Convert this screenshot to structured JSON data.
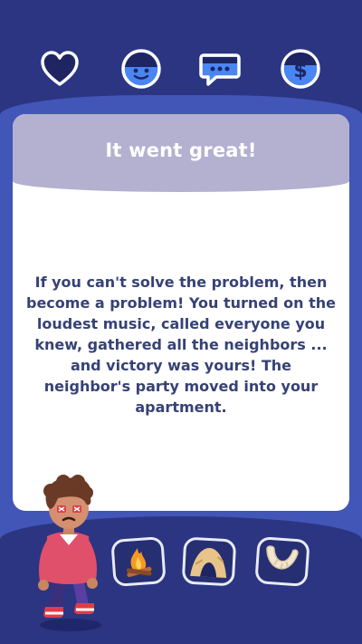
{
  "stats": {
    "items": [
      {
        "icon": "heart-icon"
      },
      {
        "icon": "face-icon"
      },
      {
        "icon": "chat-icon"
      },
      {
        "icon": "dollar-icon"
      }
    ]
  },
  "card": {
    "title": "It went great!",
    "text": "If you can't solve the problem, then become a problem! You turned on the loudest music, called everyone you knew, gathered all the neighbors ... and victory was yours! The neighbor's party moved into your apartment."
  },
  "items": [
    {
      "icon": "campfire-icon"
    },
    {
      "icon": "cave-icon"
    },
    {
      "icon": "horn-icon"
    }
  ],
  "colors": {
    "background": "#2f3b8f",
    "panel": "#4256b8",
    "card": "#ffffff",
    "header": "#b4b0d0",
    "text": "#364276",
    "accent": "#4a86f2"
  }
}
